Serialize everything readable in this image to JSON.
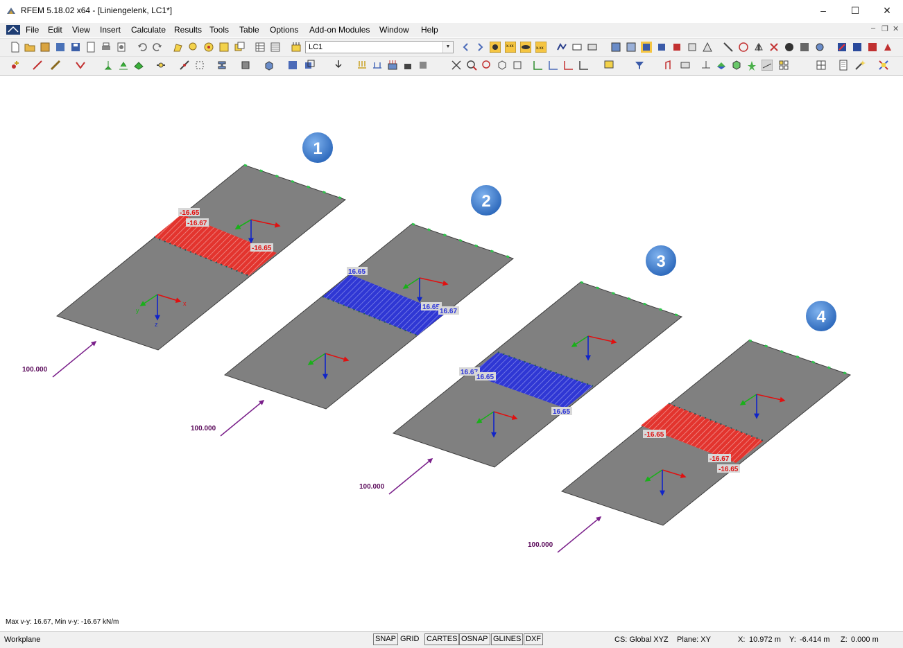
{
  "window": {
    "title": "RFEM 5.18.02 x64 - [Liniengelenk, LC1*]",
    "minimize": "–",
    "maximize": "☐",
    "close": "✕"
  },
  "menu": [
    "File",
    "Edit",
    "View",
    "Insert",
    "Calculate",
    "Results",
    "Tools",
    "Table",
    "Options",
    "Add-on Modules",
    "Window",
    "Help"
  ],
  "toolbar": {
    "load_case": "LC1"
  },
  "viewport": {
    "panels": [
      {
        "number": "1",
        "force": "100.000",
        "labels": [
          "-16.65",
          "-16.67",
          "-16.65"
        ],
        "type": "neg"
      },
      {
        "number": "2",
        "force": "100.000",
        "labels": [
          "16.65",
          "16.65",
          "16.67"
        ],
        "type": "pos"
      },
      {
        "number": "3",
        "force": "100.000",
        "labels": [
          "16.67",
          "16.65",
          "16.65"
        ],
        "type": "pos"
      },
      {
        "number": "4",
        "force": "100.000",
        "labels": [
          "-16.65",
          "-16.67",
          "-16.65"
        ],
        "type": "neg"
      }
    ],
    "axis_labels": {
      "x": "x",
      "y": "y",
      "z": "z"
    },
    "info": "Max v-y: 16.67, Min v-y: -16.67 kN/m"
  },
  "colors": {
    "slab": "#7f7f7f",
    "neg_band": "#e8302a",
    "pos_band": "#2b33d8",
    "support": "#2ec24a",
    "force": "#7a1f8a",
    "axis_x": "#e01010",
    "axis_y": "#19b019",
    "axis_z": "#1024c8",
    "badge": "#3d7fd0"
  },
  "status": {
    "workplane": "Workplane",
    "buttons": [
      "SNAP",
      "GRID",
      "CARTES",
      "OSNAP",
      "GLINES",
      "DXF"
    ],
    "cs": "CS: Global XYZ",
    "plane": "Plane: XY",
    "x_label": "X:",
    "x_value": "10.972 m",
    "y_label": "Y:",
    "y_value": "-6.414 m",
    "z_label": "Z:",
    "z_value": "0.000 m"
  }
}
